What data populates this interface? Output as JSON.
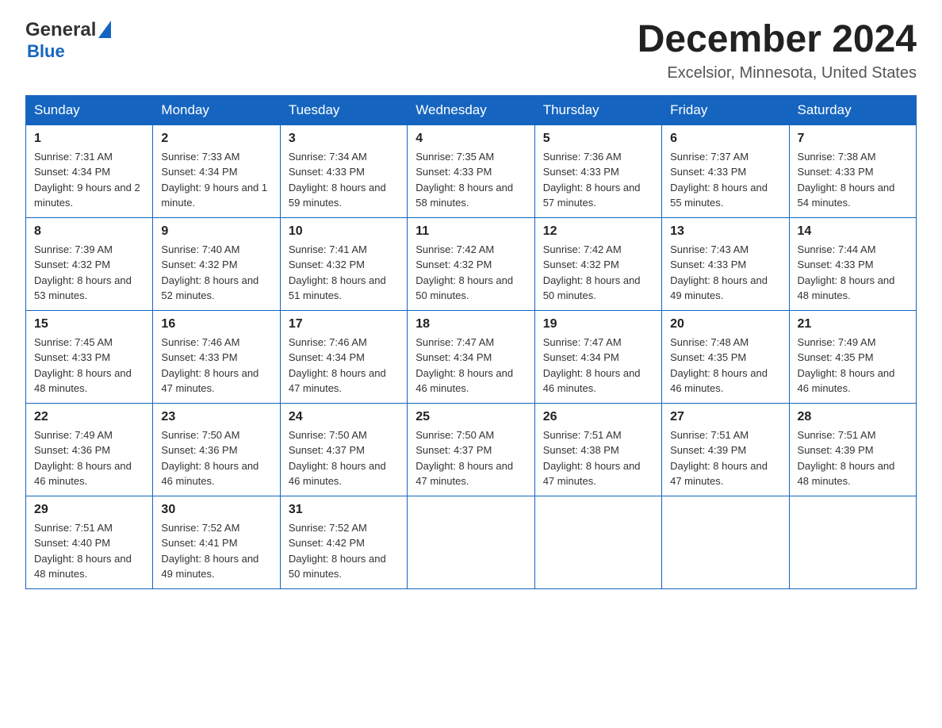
{
  "header": {
    "logo_general": "General",
    "logo_blue": "Blue",
    "title": "December 2024",
    "subtitle": "Excelsior, Minnesota, United States"
  },
  "weekdays": [
    "Sunday",
    "Monday",
    "Tuesday",
    "Wednesday",
    "Thursday",
    "Friday",
    "Saturday"
  ],
  "weeks": [
    [
      {
        "day": "1",
        "sunrise": "7:31 AM",
        "sunset": "4:34 PM",
        "daylight": "9 hours and 2 minutes."
      },
      {
        "day": "2",
        "sunrise": "7:33 AM",
        "sunset": "4:34 PM",
        "daylight": "9 hours and 1 minute."
      },
      {
        "day": "3",
        "sunrise": "7:34 AM",
        "sunset": "4:33 PM",
        "daylight": "8 hours and 59 minutes."
      },
      {
        "day": "4",
        "sunrise": "7:35 AM",
        "sunset": "4:33 PM",
        "daylight": "8 hours and 58 minutes."
      },
      {
        "day": "5",
        "sunrise": "7:36 AM",
        "sunset": "4:33 PM",
        "daylight": "8 hours and 57 minutes."
      },
      {
        "day": "6",
        "sunrise": "7:37 AM",
        "sunset": "4:33 PM",
        "daylight": "8 hours and 55 minutes."
      },
      {
        "day": "7",
        "sunrise": "7:38 AM",
        "sunset": "4:33 PM",
        "daylight": "8 hours and 54 minutes."
      }
    ],
    [
      {
        "day": "8",
        "sunrise": "7:39 AM",
        "sunset": "4:32 PM",
        "daylight": "8 hours and 53 minutes."
      },
      {
        "day": "9",
        "sunrise": "7:40 AM",
        "sunset": "4:32 PM",
        "daylight": "8 hours and 52 minutes."
      },
      {
        "day": "10",
        "sunrise": "7:41 AM",
        "sunset": "4:32 PM",
        "daylight": "8 hours and 51 minutes."
      },
      {
        "day": "11",
        "sunrise": "7:42 AM",
        "sunset": "4:32 PM",
        "daylight": "8 hours and 50 minutes."
      },
      {
        "day": "12",
        "sunrise": "7:42 AM",
        "sunset": "4:32 PM",
        "daylight": "8 hours and 50 minutes."
      },
      {
        "day": "13",
        "sunrise": "7:43 AM",
        "sunset": "4:33 PM",
        "daylight": "8 hours and 49 minutes."
      },
      {
        "day": "14",
        "sunrise": "7:44 AM",
        "sunset": "4:33 PM",
        "daylight": "8 hours and 48 minutes."
      }
    ],
    [
      {
        "day": "15",
        "sunrise": "7:45 AM",
        "sunset": "4:33 PM",
        "daylight": "8 hours and 48 minutes."
      },
      {
        "day": "16",
        "sunrise": "7:46 AM",
        "sunset": "4:33 PM",
        "daylight": "8 hours and 47 minutes."
      },
      {
        "day": "17",
        "sunrise": "7:46 AM",
        "sunset": "4:34 PM",
        "daylight": "8 hours and 47 minutes."
      },
      {
        "day": "18",
        "sunrise": "7:47 AM",
        "sunset": "4:34 PM",
        "daylight": "8 hours and 46 minutes."
      },
      {
        "day": "19",
        "sunrise": "7:47 AM",
        "sunset": "4:34 PM",
        "daylight": "8 hours and 46 minutes."
      },
      {
        "day": "20",
        "sunrise": "7:48 AM",
        "sunset": "4:35 PM",
        "daylight": "8 hours and 46 minutes."
      },
      {
        "day": "21",
        "sunrise": "7:49 AM",
        "sunset": "4:35 PM",
        "daylight": "8 hours and 46 minutes."
      }
    ],
    [
      {
        "day": "22",
        "sunrise": "7:49 AM",
        "sunset": "4:36 PM",
        "daylight": "8 hours and 46 minutes."
      },
      {
        "day": "23",
        "sunrise": "7:50 AM",
        "sunset": "4:36 PM",
        "daylight": "8 hours and 46 minutes."
      },
      {
        "day": "24",
        "sunrise": "7:50 AM",
        "sunset": "4:37 PM",
        "daylight": "8 hours and 46 minutes."
      },
      {
        "day": "25",
        "sunrise": "7:50 AM",
        "sunset": "4:37 PM",
        "daylight": "8 hours and 47 minutes."
      },
      {
        "day": "26",
        "sunrise": "7:51 AM",
        "sunset": "4:38 PM",
        "daylight": "8 hours and 47 minutes."
      },
      {
        "day": "27",
        "sunrise": "7:51 AM",
        "sunset": "4:39 PM",
        "daylight": "8 hours and 47 minutes."
      },
      {
        "day": "28",
        "sunrise": "7:51 AM",
        "sunset": "4:39 PM",
        "daylight": "8 hours and 48 minutes."
      }
    ],
    [
      {
        "day": "29",
        "sunrise": "7:51 AM",
        "sunset": "4:40 PM",
        "daylight": "8 hours and 48 minutes."
      },
      {
        "day": "30",
        "sunrise": "7:52 AM",
        "sunset": "4:41 PM",
        "daylight": "8 hours and 49 minutes."
      },
      {
        "day": "31",
        "sunrise": "7:52 AM",
        "sunset": "4:42 PM",
        "daylight": "8 hours and 50 minutes."
      },
      null,
      null,
      null,
      null
    ]
  ]
}
